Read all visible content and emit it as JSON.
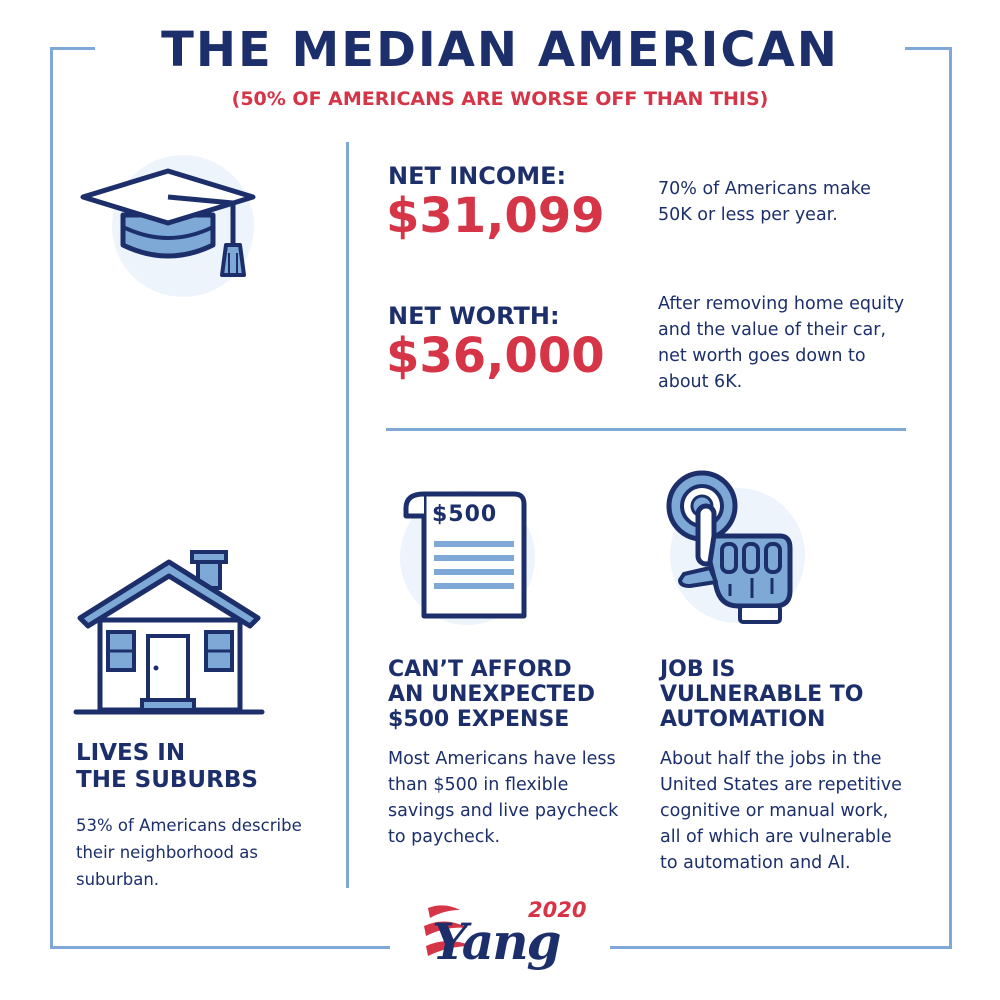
{
  "header": {
    "title": "THE MEDIAN AMERICAN",
    "subtitle": "(50% OF AMERICANS ARE WORSE OFF THAN THIS)"
  },
  "net_income": {
    "label": "NET INCOME:",
    "value": "$31,099",
    "note": "70% of Americans make 50K or less per year."
  },
  "net_worth": {
    "label": "NET WORTH:",
    "value": "$36,000",
    "note": "After removing home equity and the value of their car, net worth goes down to about 6K."
  },
  "suburbs": {
    "heading_line1": "LIVES IN",
    "heading_line2": "THE SUBURBS",
    "body": "53% of Americans describe their neighborhood as suburban."
  },
  "expense": {
    "bill_amount": "$500",
    "heading_line1": "CAN’T AFFORD",
    "heading_line2": "AN UNEXPECTED",
    "heading_line3": "$500 EXPENSE",
    "body": "Most Americans have less than $500 in flexible savings and live paycheck to paycheck."
  },
  "automation": {
    "heading_line1": "JOB IS",
    "heading_line2": "VULNERABLE TO",
    "heading_line3": "AUTOMATION",
    "body": "About half the jobs in the United States are repetitive cognitive or manual work, all of which are vulnerable to automation and AI."
  },
  "logo": {
    "year": "2020",
    "name": "Yang"
  },
  "colors": {
    "navy": "#1c2f6b",
    "red": "#d63447",
    "light_blue": "#7ea9d6",
    "mid_blue": "#5b8fcf"
  },
  "icons": [
    "graduation-cap-icon",
    "house-icon",
    "bill-icon",
    "robot-hand-icon"
  ]
}
